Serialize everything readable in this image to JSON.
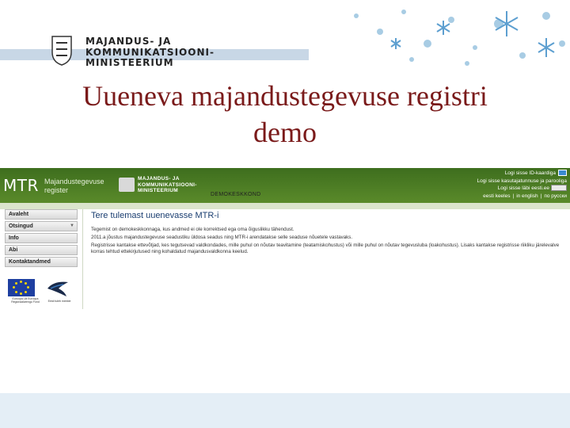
{
  "banner": {
    "ministry_line1": "MAJANDUS- JA",
    "ministry_line2": "KOMMUNIKATSIOONI-",
    "ministry_line3": "MINISTEERIUM"
  },
  "slide": {
    "title_line1": "Uueneva majandustegevuse registri",
    "title_line2": "demo"
  },
  "app": {
    "logo": "MTR",
    "logo_sub1": "Majandustegevuse",
    "logo_sub2": "register",
    "mini_ministry1": "MAJANDUS- JA",
    "mini_ministry2": "KOMMUNIKATSIOONI-",
    "mini_ministry3": "MINISTEERIUM",
    "demo_label": "DEMOKESKKOND",
    "login": {
      "id_card": "Logi sisse ID-kaardiga",
      "bank": "Logi sisse kasutajatunnuse ja parooliga",
      "keyboard": "Logi sisse läbi eesti.ee",
      "languages": [
        "eesti keeles",
        "in english",
        "по русски"
      ]
    },
    "sidebar": [
      "Avaleht",
      "Otsingud",
      "Info",
      "Abi",
      "Kontaktandmed"
    ],
    "eu_caption": "Euroopa Liit Euroopa Regionaalarengu Fond",
    "ee_caption": "Eesti tuleb meelde",
    "content": {
      "title": "Tere tulemast uuenevasse MTR-i",
      "p1": "Tegemist on demokeskkonnaga, kus andmed ei ole korrektsed ega oma õiguslikku tähendust.",
      "p2": "2011.a jõustus majandustegevuse seadustiku üldosa seadus ning MTR-i arendatakse selle seaduse nõuetele vastavaks.",
      "p3": "Registrisse kantakse ettevõtjad, kes tegutsevad valdkondades, mille puhul on nõutav teavitamine (teatamiskohustus) või mille puhul on nõutav tegevusluba (loakohustus). Lisaks kantakse registrisse riikliku järelevalve korras tehtud ettekirjutused ning kohaldatud majandusvaldkonna keelud."
    }
  },
  "colors": {
    "title": "#7a1a1a",
    "header_green": "#4a7c23"
  }
}
